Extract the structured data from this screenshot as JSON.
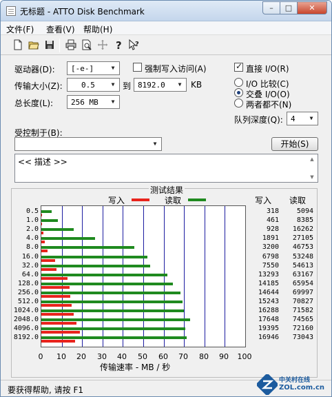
{
  "window": {
    "title": "无标题 - ATTO Disk Benchmark"
  },
  "caption_buttons": {
    "minimize": "–",
    "maximize": "□",
    "close": "✕"
  },
  "menu": [
    {
      "label": "文件(F)"
    },
    {
      "label": "查看(V)"
    },
    {
      "label": "帮助(H)"
    }
  ],
  "toolbar_icons": [
    "new-file-icon",
    "open-folder-icon",
    "save-icon",
    "print-icon",
    "print-preview-icon",
    "move-icon",
    "help-icon",
    "context-help-icon"
  ],
  "form": {
    "drive_label": "驱动器(D):",
    "drive_value": "[-e-]",
    "force_write_label": "强制写入访问(A)",
    "force_write_checked": false,
    "transfer_size_label": "传输大小(Z):",
    "transfer_from": "0.5",
    "to_label": "到",
    "transfer_to": "8192.0",
    "unit_label": "KB",
    "total_length_label": "总长度(L):",
    "total_length_value": "256 MB",
    "direct_io_label": "直接 I/O(R)",
    "direct_io_checked": true,
    "io_compare_label": "I/O 比较(C)",
    "overlapped_io_label": "交叠 I/O(O)",
    "neither_label": "两者都不(N)",
    "selected_io_mode": "overlapped",
    "queue_depth_label": "队列深度(Q):",
    "queue_depth_value": "4",
    "controlled_by_label": "受控制于(B):",
    "controlled_by_value": "",
    "start_button": "开始(S)",
    "description_text": "<< 描述 >>"
  },
  "results": {
    "title": "测试结果",
    "legend_write": "写入",
    "legend_read": "读取",
    "col_write": "写入",
    "col_read": "读取",
    "xaxis_label": "传输速率 - MB / 秒",
    "xticks": [
      "0",
      "10",
      "20",
      "30",
      "40",
      "50",
      "60",
      "70",
      "80",
      "90",
      "100"
    ]
  },
  "chart_data": {
    "type": "bar",
    "orientation": "horizontal",
    "title": "测试结果",
    "xlabel": "传输速率 - MB / 秒",
    "xlim": [
      0,
      100
    ],
    "grid": true,
    "legend_placement": "top",
    "colors": {
      "write": "#e8231c",
      "read": "#1f8a1f"
    },
    "categories": [
      "0.5",
      "1.0",
      "2.0",
      "4.0",
      "8.0",
      "16.0",
      "32.0",
      "64.0",
      "128.0",
      "256.0",
      "512.0",
      "1024.0",
      "2048.0",
      "4096.0",
      "8192.0"
    ],
    "series": [
      {
        "name": "写入",
        "values": [
          318,
          461,
          928,
          1891,
          3200,
          6798,
          7550,
          13293,
          14185,
          14644,
          15243,
          16288,
          17648,
          19395,
          16946
        ]
      },
      {
        "name": "读取",
        "values": [
          5094,
          8385,
          16262,
          27105,
          46753,
          53248,
          54613,
          63167,
          65954,
          69997,
          70827,
          71582,
          74565,
          72160,
          73043
        ]
      }
    ]
  },
  "status": {
    "text": "要获得帮助, 请按 F1"
  },
  "watermark": {
    "cn": "中关村在线",
    "en": "ZOL.com.cn"
  }
}
